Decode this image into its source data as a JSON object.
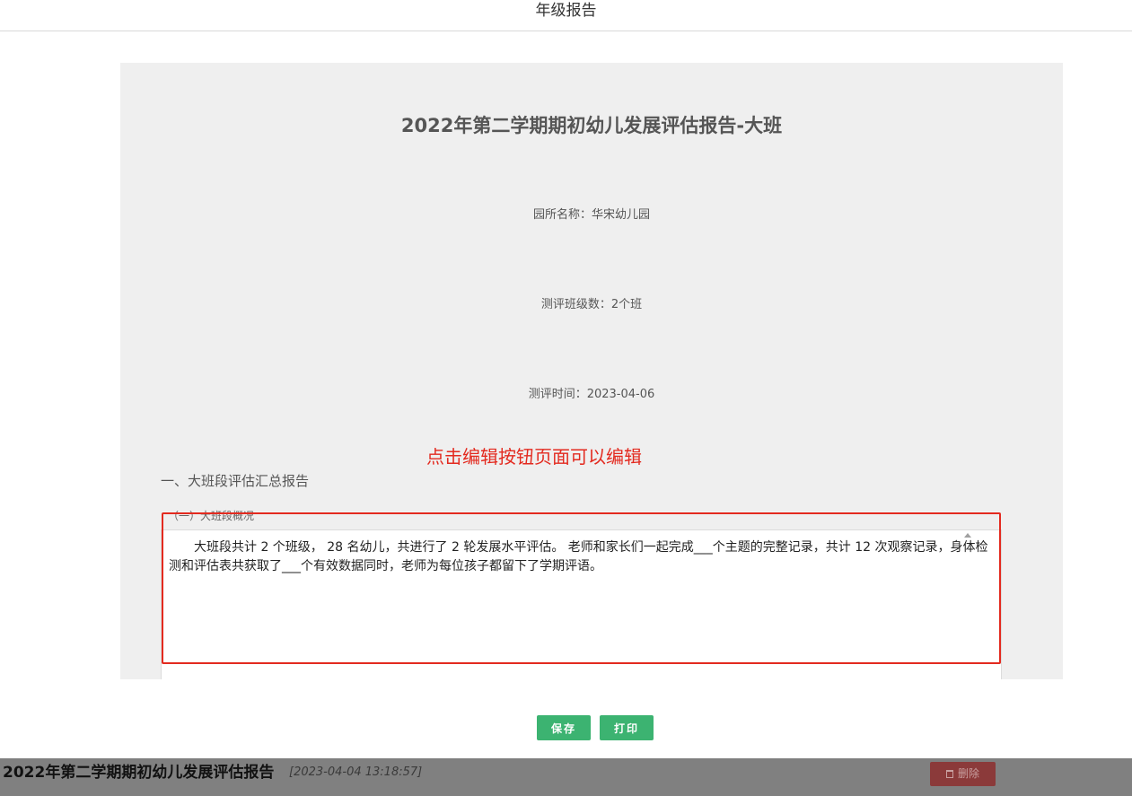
{
  "header": {
    "title": "年级报告"
  },
  "report": {
    "title": "2022年第二学期期初幼儿发展评估报告-大班",
    "kindergarten": "园所名称：华宋幼儿园",
    "class_count": "测评班级数：2个班",
    "eval_time": "测评时间：2023-04-06",
    "annotation": "点击编辑按钮页面可以编辑",
    "section_heading": "一、大班段评估汇总报告",
    "subsection_heading": "（一）大班段概况",
    "editor_text": "大班段共计 2 个班级， 28 名幼儿，共进行了 2 轮发展水平评估。 老师和家长们一起完成___个主题的完整记录，共计 12 次观察记录，身体检测和评估表共获取了___个有效数据同时，老师为每位孩子都留下了学期评语。"
  },
  "actions": {
    "save_label": "保存",
    "print_label": "打印"
  },
  "footer": {
    "title": "2022年第二学期期初幼儿发展评估报告",
    "timestamp": "[2023-04-04 13:18:57]",
    "delete_label": "删除"
  },
  "colors": {
    "accent_green": "#3cb371",
    "annotation_red": "#e32a1f",
    "delete_red": "#8b3a3a",
    "footer_gray": "#808080",
    "panel_gray": "#efefef"
  }
}
